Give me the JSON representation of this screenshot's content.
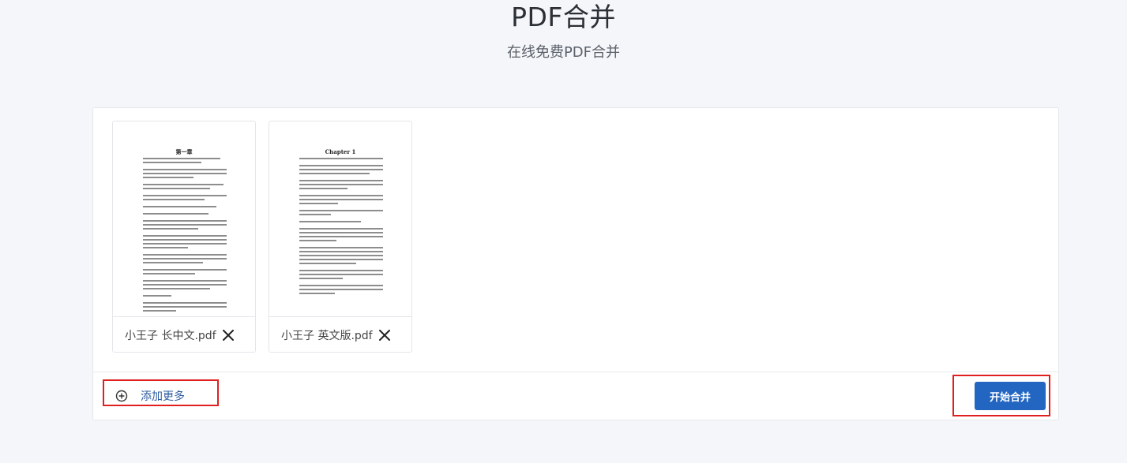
{
  "header": {
    "title": "PDF合并",
    "subtitle": "在线免费PDF合并"
  },
  "files": [
    {
      "name": "小王子 长中文.pdf",
      "preview_heading": "第一章",
      "remove_icon": "close-icon"
    },
    {
      "name": "小王子 英文版.pdf",
      "preview_heading": "Chapter 1",
      "remove_icon": "close-icon"
    }
  ],
  "actions": {
    "add_more_label": "添加更多",
    "add_more_icon": "plus-circle-icon",
    "merge_label": "开始合并"
  },
  "colors": {
    "accent": "#2366c2",
    "link": "#2c5c9f",
    "highlight": "#e02020"
  }
}
